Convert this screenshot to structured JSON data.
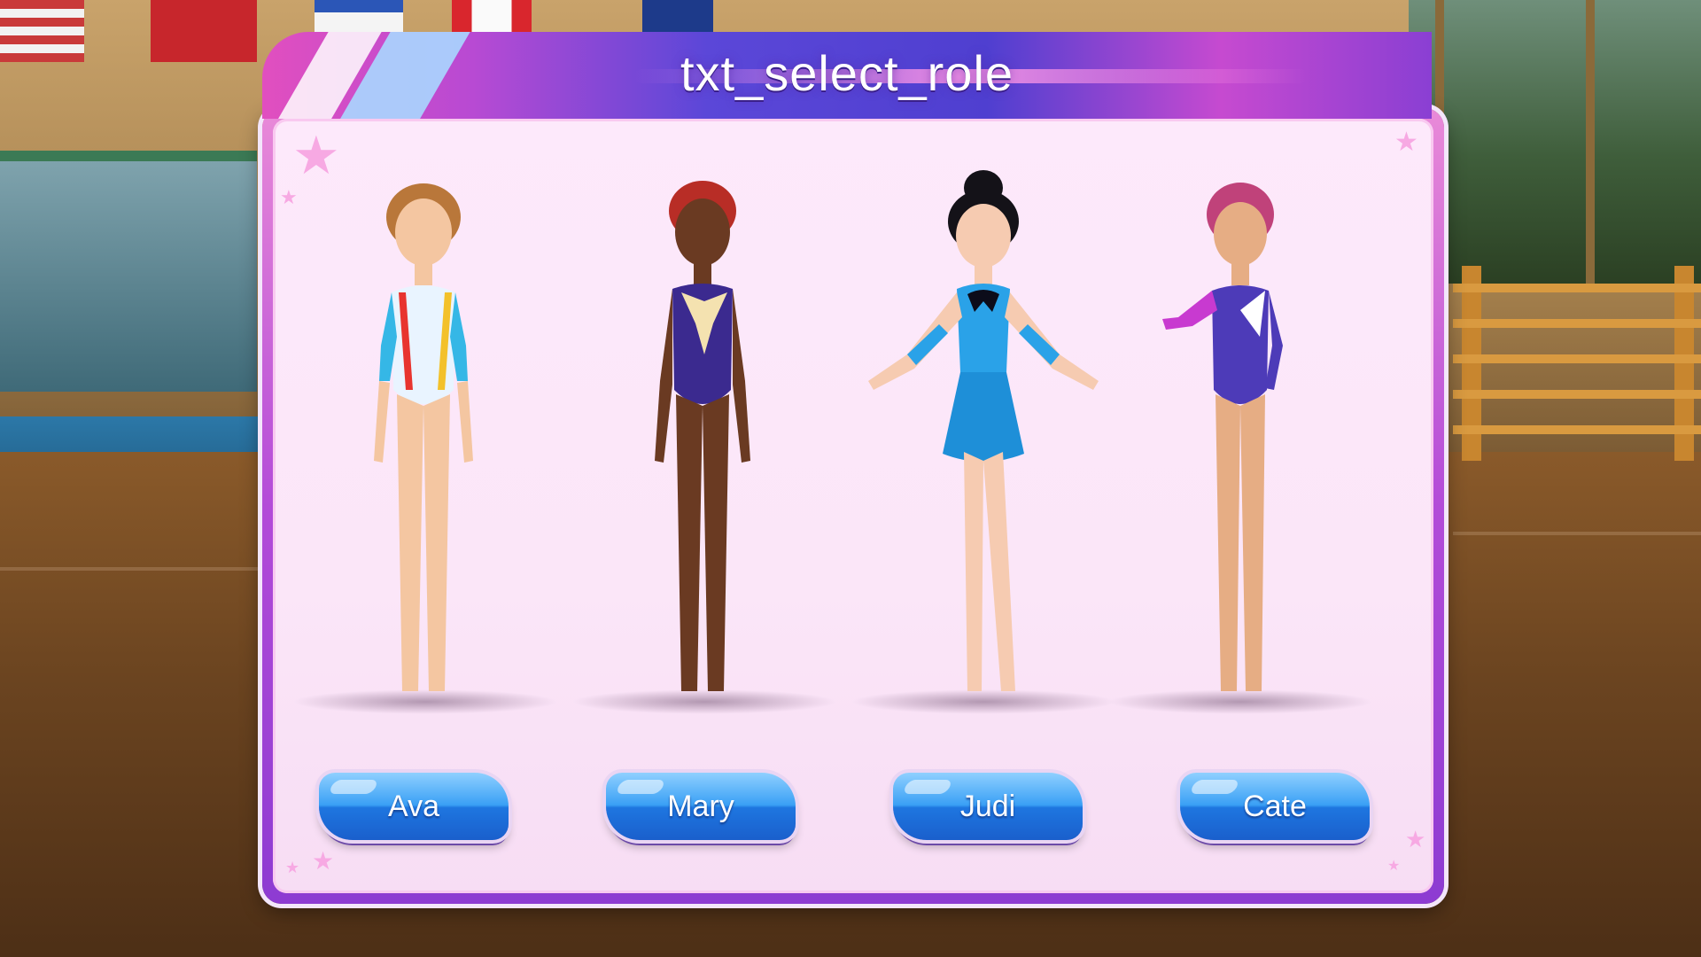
{
  "dialog": {
    "title": "txt_select_role"
  },
  "roles": [
    {
      "name": "Ava",
      "outfit_colors": [
        "#e9f4ff",
        "#35b7e6",
        "#e8342e",
        "#f3c12a"
      ],
      "hair_color": "#b9773a",
      "skin_color": "#f4c6a1"
    },
    {
      "name": "Mary",
      "outfit_colors": [
        "#3b2a8f",
        "#f4e2b0"
      ],
      "hair_color": "#b82d26",
      "skin_color": "#6a3a22"
    },
    {
      "name": "Judi",
      "outfit_colors": [
        "#2aa2e8",
        "#0c0c1a"
      ],
      "hair_color": "#141218",
      "skin_color": "#f6cbb1"
    },
    {
      "name": "Cate",
      "outfit_colors": [
        "#4d3bb8",
        "#c83ad0",
        "#ffffff"
      ],
      "hair_color": "#c0427a",
      "skin_color": "#e6ad84"
    }
  ],
  "colors": {
    "dialog_border": "#b34bd8",
    "dialog_fill": "#fde9fb",
    "button_blue": "#1e76e0"
  },
  "icons": [
    "star-icon"
  ]
}
